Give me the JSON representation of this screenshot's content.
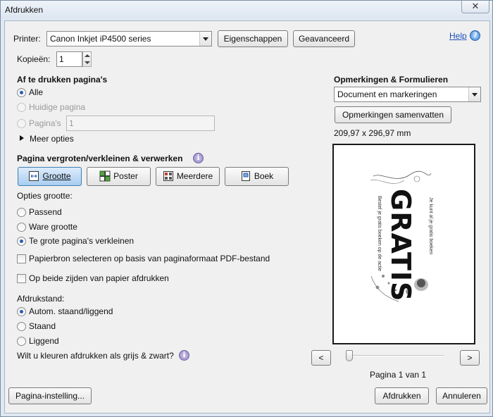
{
  "window": {
    "title": "Afdrukken",
    "close_glyph": "✕"
  },
  "printer": {
    "label": "Printer:",
    "selected": "Canon Inkjet iP4500 series",
    "properties_button": "Eigenschappen",
    "advanced_button": "Geavanceerd",
    "help_link": "Help"
  },
  "copies": {
    "label": "Kopieën:",
    "value": "1"
  },
  "pages": {
    "heading": "Af te drukken pagina's",
    "all": "Alle",
    "current": "Huidige pagina",
    "range_label": "Pagina's",
    "range_value": "1",
    "more_options": "Meer opties"
  },
  "sizing": {
    "heading": "Pagina vergroten/verkleinen & verwerken",
    "tabs": [
      "Grootte",
      "Poster",
      "Meerdere",
      "Boek"
    ],
    "options_label": "Opties grootte:",
    "fit": "Passend",
    "actual": "Ware grootte",
    "shrink": "Te grote pagina's verkleinen",
    "paper_source": "Papierbron selecteren op basis van paginaformaat PDF-bestand",
    "duplex": "Op beide zijden van papier afdrukken"
  },
  "orientation": {
    "label": "Afdrukstand:",
    "auto": "Autom. staand/liggend",
    "portrait": "Staand",
    "landscape": "Liggend"
  },
  "grayscale_question": "Wilt u kleuren afdrukken als grijs & zwart?",
  "comments": {
    "heading": "Opmerkingen & Formulieren",
    "selected": "Document en markeringen",
    "summarize_button": "Opmerkingen samenvatten",
    "page_size": "209,97 x 296,97 mm"
  },
  "preview": {
    "big_text": "GRATIS",
    "page_indicator": "Pagina 1 van 1",
    "prev_glyph": "<",
    "next_glyph": ">"
  },
  "footer": {
    "page_setup_button": "Pagina-instelling...",
    "print_button": "Afdrukken",
    "cancel_button": "Annuleren"
  },
  "colors": {
    "accent_blue": "#2a5cb5",
    "link": "#1a4fb8",
    "selected_tab_bg": "#bcd6f3"
  },
  "icons": [
    "close-icon",
    "dropdown-arrow-icon",
    "spin-up-icon",
    "spin-down-icon",
    "info-icon",
    "expand-triangle-icon",
    "size-icon",
    "poster-icon",
    "multiple-icon",
    "booklet-icon"
  ]
}
